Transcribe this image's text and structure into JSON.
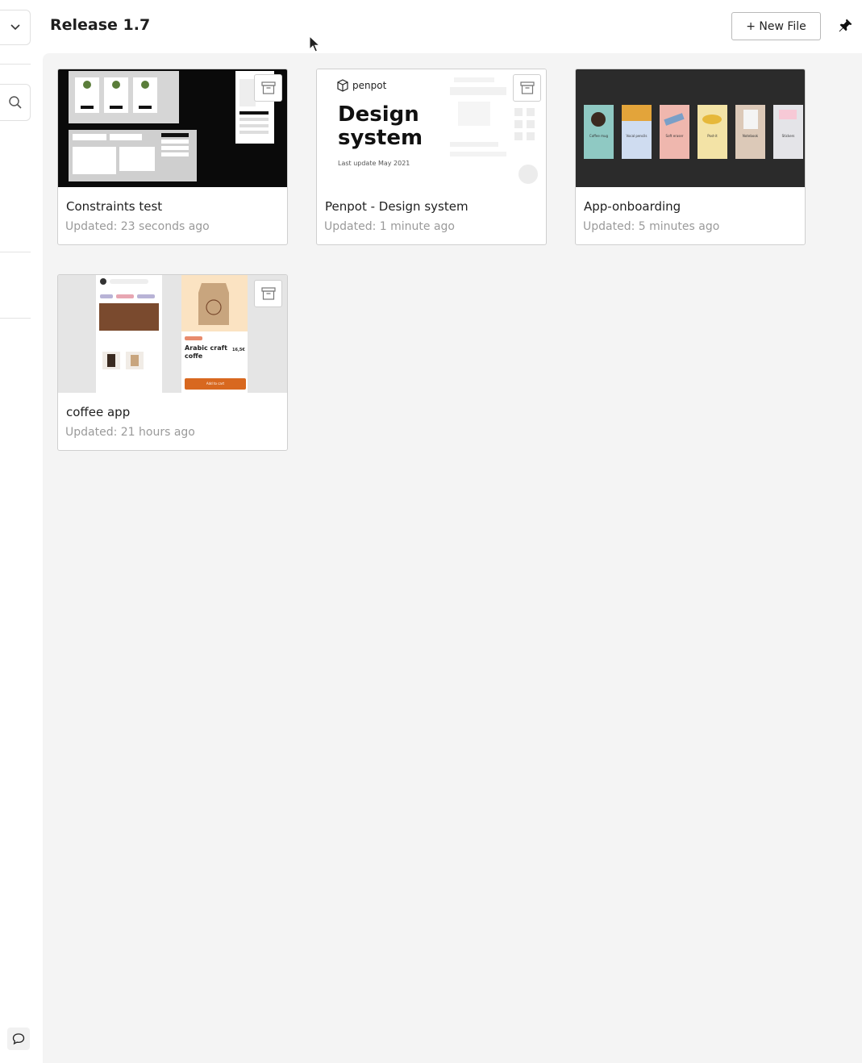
{
  "header": {
    "title": "Release 1.7",
    "new_file_label": "+ New File",
    "pin_icon": "pin-icon"
  },
  "sidebar": {
    "dropdown_icon": "chevron-down-icon",
    "search_icon": "search-icon",
    "comment_icon": "comment-icon"
  },
  "files": [
    {
      "name": "Constraints test",
      "updated": "Updated: 23 seconds ago"
    },
    {
      "name": "Penpot - Design system",
      "updated": "Updated: 1 minute ago",
      "thumb": {
        "brand": "penpot",
        "heading_line1": "Design",
        "heading_line2": "system",
        "subtitle": "Last update May 2021"
      }
    },
    {
      "name": "App-onboarding",
      "updated": "Updated: 5 minutes ago",
      "thumb": {
        "screens": [
          "Coffee mug",
          "Vocal pencils",
          "Soft eraser",
          "Post-it",
          "Notebook",
          "Stickers"
        ]
      }
    },
    {
      "name": "coffee app",
      "updated": "Updated: 21 hours ago",
      "thumb": {
        "product_title_line1": "Arabic craft",
        "product_title_line2": "coffe",
        "price": "16,5€",
        "cta": "Add to cart"
      }
    }
  ],
  "colors": {
    "main_bg": "#f4f4f4",
    "card_border": "#cfcfcf",
    "muted_text": "#9a9a9a",
    "cta_orange": "#d8681f"
  }
}
